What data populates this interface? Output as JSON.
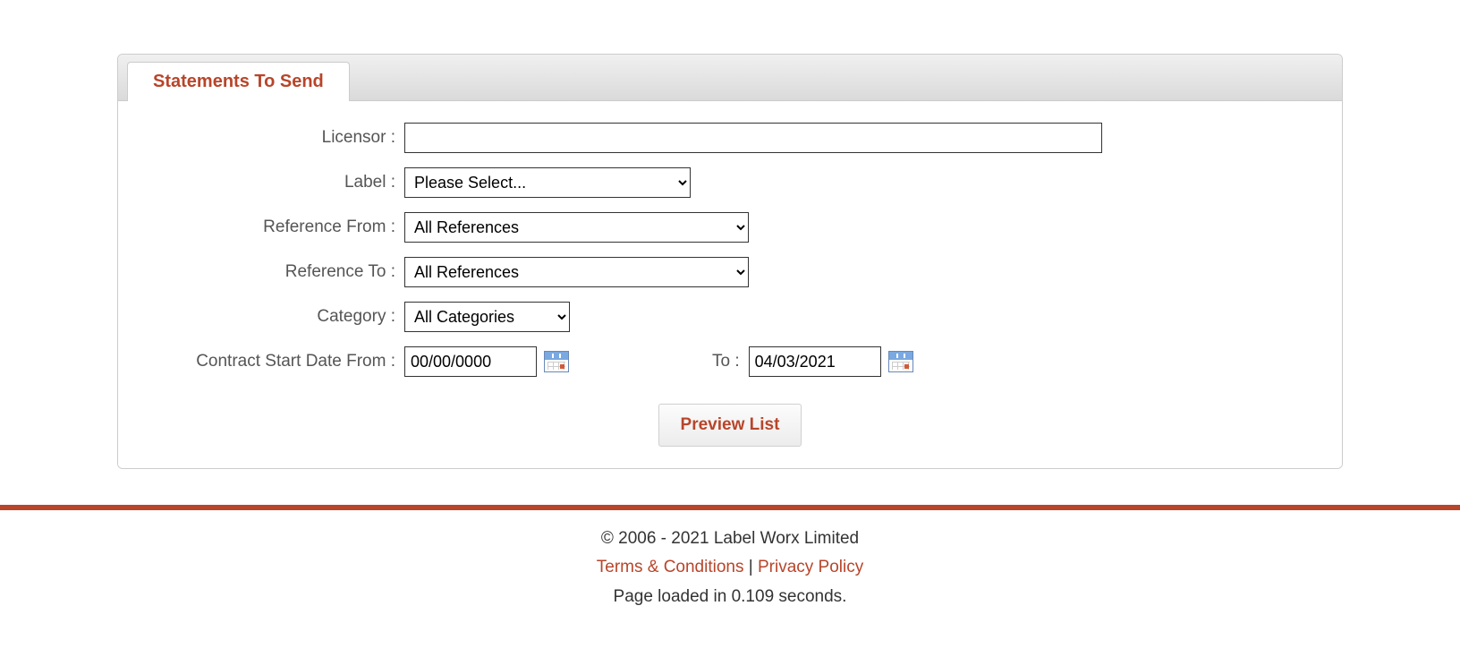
{
  "tab": {
    "title": "Statements To Send"
  },
  "form": {
    "licensor": {
      "label": "Licensor :",
      "value": ""
    },
    "label": {
      "label": "Label :",
      "selected": "Please Select..."
    },
    "referenceFrom": {
      "label": "Reference From :",
      "selected": "All References"
    },
    "referenceTo": {
      "label": "Reference To :",
      "selected": "All References"
    },
    "category": {
      "label": "Category :",
      "selected": "All Categories"
    },
    "dateFrom": {
      "label": "Contract Start Date From :",
      "value": "00/00/0000"
    },
    "dateTo": {
      "label": "To :",
      "value": "04/03/2021"
    },
    "previewBtn": "Preview List"
  },
  "footer": {
    "copyright": "© 2006 - 2021 Label Worx Limited",
    "terms": "Terms & Conditions",
    "privacy": "Privacy Policy",
    "pipe": " | ",
    "loadTime": "Page loaded in 0.109 seconds."
  }
}
